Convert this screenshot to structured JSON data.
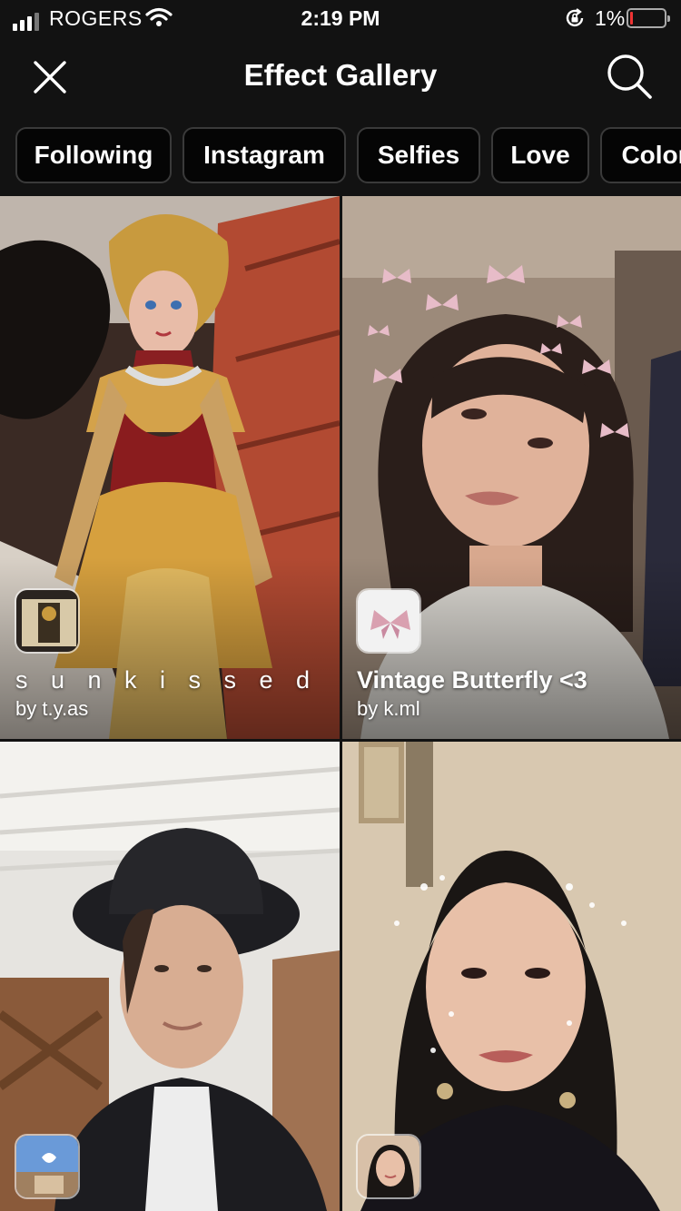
{
  "status_bar": {
    "carrier": "ROGERS",
    "time": "2:19 PM",
    "battery_percent": "1%",
    "battery_level": 0.01,
    "icons": [
      "signal-icon",
      "wifi-icon",
      "rotation-lock-icon",
      "battery-icon"
    ]
  },
  "header": {
    "title": "Effect Gallery",
    "close_icon": "close-icon",
    "search_icon": "search-icon"
  },
  "categories": [
    {
      "label": "Following"
    },
    {
      "label": "Instagram"
    },
    {
      "label": "Selfies"
    },
    {
      "label": "Love"
    },
    {
      "label": "Color"
    }
  ],
  "effects": [
    {
      "name": "s u n k i s s e d",
      "author": "by t.y.as"
    },
    {
      "name": "Vintage Butterfly <3",
      "author": "by k.ml"
    },
    {
      "name": "",
      "author": ""
    },
    {
      "name": "",
      "author": ""
    }
  ],
  "colors": {
    "background": "#121212",
    "chip_background": "#050505",
    "chip_border": "#3a3a3a",
    "text": "#ffffff"
  }
}
